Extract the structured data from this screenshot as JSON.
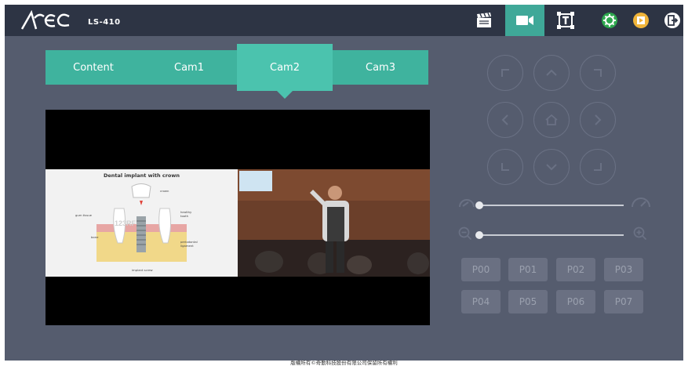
{
  "header": {
    "brand": "Arec",
    "model": "LS-410",
    "toolbar": [
      {
        "name": "clapperboard-icon"
      },
      {
        "name": "camera-icon"
      },
      {
        "name": "layout-icon"
      },
      {
        "name": "settings-icon"
      },
      {
        "name": "media-icon"
      },
      {
        "name": "logout-icon"
      }
    ],
    "active_tool": "camera-icon",
    "accent": "#3fa898"
  },
  "tabs": [
    {
      "label": "Content"
    },
    {
      "label": "Cam1"
    },
    {
      "label": "Cam2"
    },
    {
      "label": "Cam3"
    }
  ],
  "active_tab": "Cam2",
  "preview": {
    "slide_title": "Dental implant with crown",
    "slide_labels": [
      "crown",
      "gum tissue",
      "healthy tooth",
      "bone",
      "periodontal ligament",
      "implant screw"
    ],
    "watermark": "123RF"
  },
  "ptz": {
    "buttons": [
      "up-left",
      "up",
      "up-right",
      "left",
      "home",
      "right",
      "down-left",
      "down",
      "down-right"
    ]
  },
  "speed_slider": {
    "value": 0.0
  },
  "zoom_slider": {
    "value": 0.0
  },
  "presets": [
    "P00",
    "P01",
    "P02",
    "P03",
    "P04",
    "P05",
    "P06",
    "P07"
  ],
  "footer": "版權所有©奇勤科技股份有限公司保留所有權利"
}
